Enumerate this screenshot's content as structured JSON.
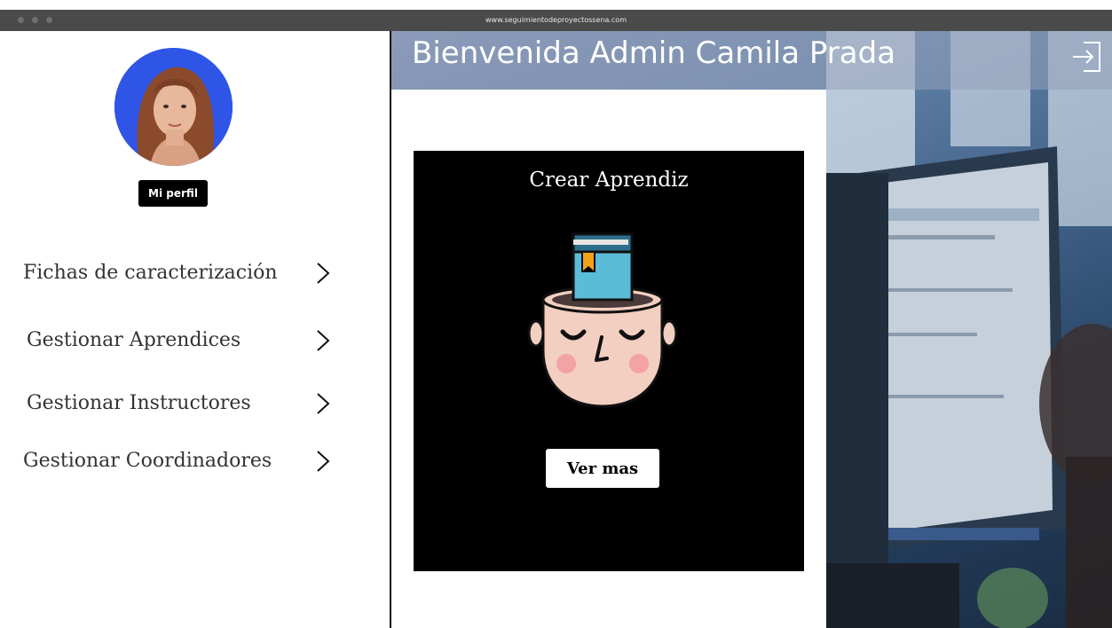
{
  "browser": {
    "url": "www.seguimientodeproyectossena.com"
  },
  "header": {
    "title": "Bienvenida Admin Camila Prada"
  },
  "sidebar": {
    "profile_button": "Mi perfil",
    "items": [
      {
        "label": "Fichas de caracterización"
      },
      {
        "label": "Gestionar Aprendices"
      },
      {
        "label": "Gestionar Instructores"
      },
      {
        "label": "Gestionar Coordinadores"
      }
    ]
  },
  "card": {
    "title": "Crear Aprendiz",
    "button": "Ver mas"
  },
  "icons": [
    "avatar-photo",
    "chevron-right-icon",
    "logout-icon",
    "book-head-illustration"
  ],
  "colors": {
    "avatar_bg": "#2e55e6",
    "card_bg": "#000000",
    "chrome": "#4a4a4a"
  }
}
